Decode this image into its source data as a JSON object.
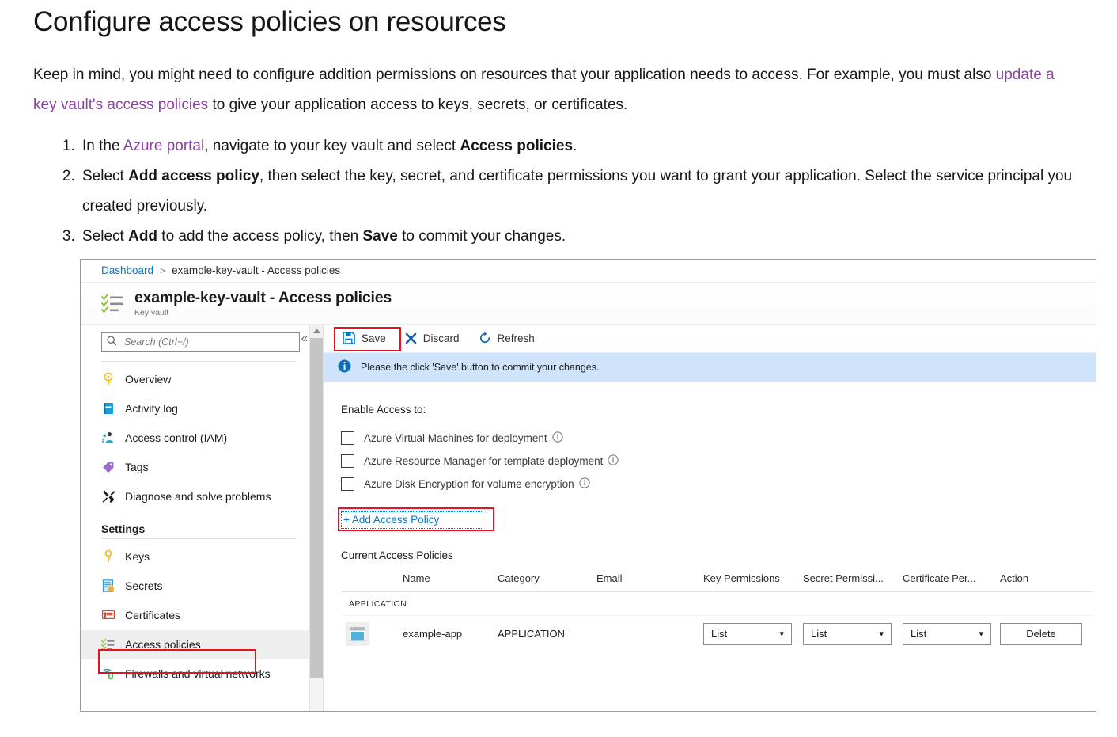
{
  "doc": {
    "title": "Configure access policies on resources",
    "intro_part1": "Keep in mind, you might need to configure addition permissions on resources that your application needs to access. For example, you must also ",
    "intro_link": "update a key vault's access policies",
    "intro_part2": " to give your application access to keys, secrets, or certificates.",
    "steps": [
      {
        "pre": "In the ",
        "link": "Azure portal",
        "mid": ", navigate to your key vault and select ",
        "bold": "Access policies",
        "post": "."
      },
      {
        "pre": "Select ",
        "bold": "Add access policy",
        "mid": ", then select the key, secret, and certificate permissions you want to grant your application. Select the service principal you created previously.",
        "post": ""
      },
      {
        "pre": "Select ",
        "bold": "Add",
        "mid": " to add the access policy, then ",
        "bold2": "Save",
        "post": " to commit your changes."
      }
    ]
  },
  "portal": {
    "breadcrumb": {
      "root": "Dashboard",
      "separator": ">",
      "current": "example-key-vault - Access policies"
    },
    "blade": {
      "title": "example-key-vault - Access policies",
      "subtitle": "Key vault"
    },
    "search": {
      "placeholder": "Search (Ctrl+/)",
      "value": ""
    },
    "nav": {
      "collapse_glyph": "«",
      "items": [
        {
          "label": "Overview",
          "icon": "key-icon",
          "selected": false
        },
        {
          "label": "Activity log",
          "icon": "activity-log-icon",
          "selected": false
        },
        {
          "label": "Access control (IAM)",
          "icon": "access-control-icon",
          "selected": false
        },
        {
          "label": "Tags",
          "icon": "tag-icon",
          "selected": false
        },
        {
          "label": "Diagnose and solve problems",
          "icon": "wrench-icon",
          "selected": false
        }
      ],
      "group_label": "Settings",
      "settings_items": [
        {
          "label": "Keys",
          "icon": "key-icon",
          "selected": false
        },
        {
          "label": "Secrets",
          "icon": "secrets-icon",
          "selected": false
        },
        {
          "label": "Certificates",
          "icon": "certificate-icon",
          "selected": false
        },
        {
          "label": "Access policies",
          "icon": "access-policies-icon",
          "selected": true
        },
        {
          "label": "Firewalls and virtual networks",
          "icon": "firewall-icon",
          "selected": false
        }
      ]
    },
    "toolbar": {
      "save_label": "Save",
      "discard_label": "Discard",
      "refresh_label": "Refresh"
    },
    "infobar": {
      "message": "Please the click 'Save' button to commit your changes."
    },
    "enable_access": {
      "label": "Enable Access to:",
      "options": [
        {
          "label": "Azure Virtual Machines for deployment",
          "checked": false,
          "has_info": true
        },
        {
          "label": "Azure Resource Manager for template deployment",
          "checked": false,
          "has_info": true
        },
        {
          "label": "Azure Disk Encryption for volume encryption",
          "checked": false,
          "has_info": true
        }
      ]
    },
    "add_access_policy": {
      "label": "+ Add Access Policy"
    },
    "table": {
      "caption": "Current Access Policies",
      "headers": [
        "",
        "Name",
        "Category",
        "Email",
        "Key Permissions",
        "Secret Permissi...",
        "Certificate Per...",
        "Action"
      ],
      "group_row": "APPLICATION",
      "rows": [
        {
          "icon": "application-icon",
          "name": "example-app",
          "category": "APPLICATION",
          "email": "",
          "key_permissions": "List",
          "secret_permissions": "List",
          "certificate_permissions": "List",
          "action": "Delete"
        }
      ]
    },
    "colors": {
      "accent_blue": "#0078d4",
      "highlight_red": "#e81123",
      "info_bg": "#cfe4fa",
      "selected_nav_bg": "#eeeeee"
    }
  }
}
